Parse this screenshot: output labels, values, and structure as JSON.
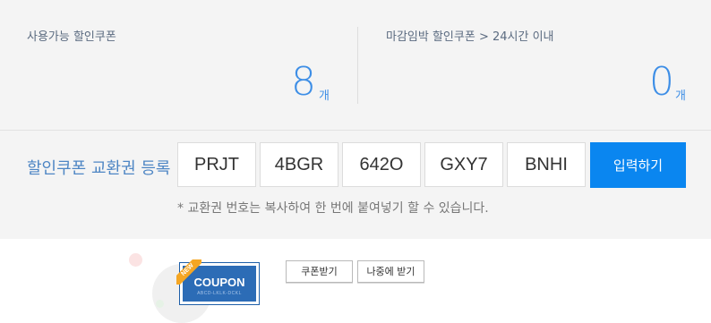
{
  "summary": {
    "available": {
      "label": "사용가능 할인쿠폰",
      "count": "8",
      "unit": "개"
    },
    "expiring": {
      "label": "마감임박 할인쿠폰 > 24시간 이내",
      "count": "0",
      "unit": "개"
    }
  },
  "register": {
    "title": "할인쿠폰 교환권 등록",
    "codes": [
      "PRJT",
      "4BGR",
      "642O",
      "GXY7",
      "BNHI"
    ],
    "submit_label": "입력하기",
    "hint": "* 교환권 번호는 복사하여 한 번에 붙여넣기 할 수 있습니다."
  },
  "coupon": {
    "badge": "NEW",
    "title": "COUPON",
    "code": "ABCD-LKLK-DCKL",
    "receive_label": "쿠폰받기",
    "later_label": "나중에 받기"
  },
  "colors": {
    "accent": "#3d8ee6",
    "button": "#0a86f0",
    "coupon": "#2c6cb6",
    "badge": "#f5a623"
  }
}
